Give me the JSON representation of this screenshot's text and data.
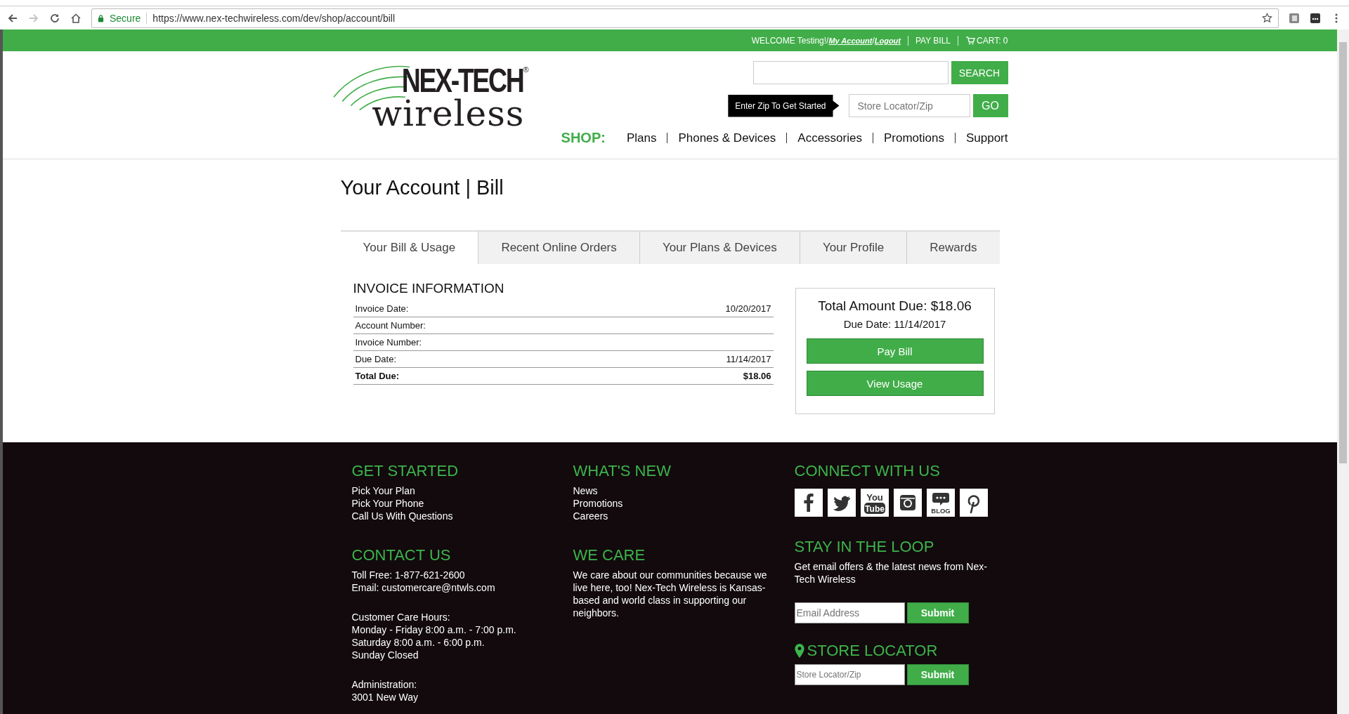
{
  "browser": {
    "secure_label": "Secure",
    "url": "https://www.nex-techwireless.com/dev/shop/account/bill",
    "forward_disabled": true
  },
  "top_bar": {
    "welcome": "WELCOME Testing!/",
    "my_account": "My Account",
    "slash": "/",
    "logout": "Logout",
    "pay_bill": "PAY BILL",
    "cart": "CART: 0"
  },
  "header": {
    "logo": {
      "brand": "NEX-TECH",
      "registered": "®",
      "sub": "wireless"
    },
    "search": {
      "button": "SEARCH"
    },
    "store_locator": {
      "tooltip": "Enter Zip To Get Started",
      "placeholder": "Store Locator/Zip",
      "button": "GO"
    },
    "nav": {
      "label": "SHOP:",
      "items": [
        "Plans",
        "Phones & Devices",
        "Accessories",
        "Promotions",
        "Support"
      ]
    }
  },
  "page_title": "Your Account | Bill",
  "tabs": [
    {
      "label": "Your Bill & Usage",
      "selected": true
    },
    {
      "label": "Recent Online Orders",
      "selected": false
    },
    {
      "label": "Your Plans & Devices",
      "selected": false
    },
    {
      "label": "Your Profile",
      "selected": false
    },
    {
      "label": "Rewards",
      "selected": false
    }
  ],
  "invoice": {
    "heading": "INVOICE INFORMATION",
    "rows": [
      {
        "label": "Invoice Date:",
        "value": "10/20/2017",
        "kind": "plain"
      },
      {
        "label": "Account Number:",
        "kind": "plain"
      },
      {
        "label": "Invoice Number:",
        "kind": "plain"
      },
      {
        "label": "Due Date:",
        "value": "11/14/2017",
        "kind": "plain"
      },
      {
        "label": "Total Due:",
        "value": "$18.06",
        "kind": "total"
      }
    ]
  },
  "summary": {
    "total": "Total Amount Due: $18.06",
    "due_date": "Due Date: 11/14/2017",
    "buttons": [
      "Pay Bill",
      "View Usage"
    ]
  },
  "footer": {
    "get_started": {
      "heading": "GET STARTED",
      "links": [
        "Pick Your Plan",
        "Pick Your Phone",
        "Call Us With Questions"
      ]
    },
    "contact": {
      "heading": "CONTACT US",
      "lines": [
        "Toll Free: 1-877-621-2600",
        "Email: customercare@ntwls.com"
      ],
      "hours_label": "Customer Care Hours:",
      "hours": [
        "Monday - Friday 8:00 a.m. - 7:00 p.m.",
        "Saturday 8:00 a.m. - 6:00 p.m.",
        "Sunday Closed"
      ],
      "admin_label": "Administration:",
      "admin_lines": [
        "3001 New Way"
      ]
    },
    "whats_new": {
      "heading": "WHAT'S NEW",
      "links": [
        "News",
        "Promotions",
        "Careers"
      ]
    },
    "we_care": {
      "heading": "WE CARE",
      "text": "We care about our communities because we live here, too! Nex-Tech Wireless is Kansas-based and world class in supporting our neighbors."
    },
    "connect": {
      "heading": "CONNECT WITH US",
      "social": [
        {
          "kind": "facebook"
        },
        {
          "kind": "twitter"
        },
        {
          "kind": "youtube",
          "lines": [
            "You",
            "Tube"
          ]
        },
        {
          "kind": "instagram"
        },
        {
          "kind": "blog",
          "lines": [
            "BLOG"
          ]
        },
        {
          "kind": "pinterest"
        }
      ]
    },
    "loop": {
      "heading": "STAY IN THE LOOP",
      "text": "Get email offers & the latest news from Nex-Tech Wireless",
      "placeholder": "Email Address",
      "button": "Submit"
    },
    "locator": {
      "heading": "STORE LOCATOR",
      "placeholder": "Store Locator/Zip",
      "button": "Submit"
    }
  }
}
